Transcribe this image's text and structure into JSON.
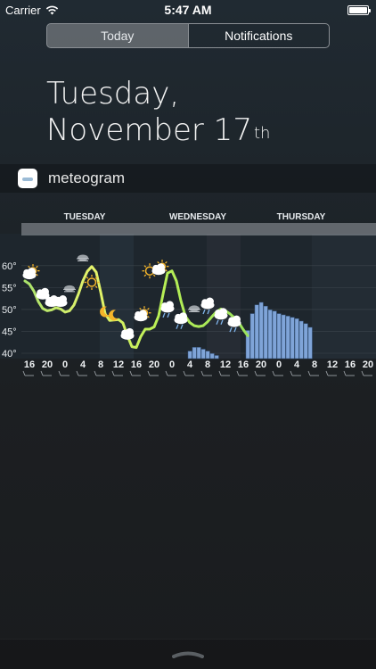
{
  "status_bar": {
    "carrier": "Carrier",
    "time": "5:47 AM"
  },
  "tabs": [
    {
      "label": "Today",
      "active": true
    },
    {
      "label": "Notifications",
      "active": false
    }
  ],
  "date_header": {
    "line1": "Tuesday,",
    "line2": "November 17",
    "suffix": "th"
  },
  "widget": {
    "title": "meteogram",
    "icon": "meteogram-app-icon"
  },
  "chart_data": {
    "type": "line",
    "days": [
      "TUESDAY",
      "WEDNESDAY",
      "THURSDAY"
    ],
    "x_tick_labels": [
      "16",
      "20",
      "0",
      "4",
      "8",
      "12",
      "16",
      "20",
      "0",
      "4",
      "8",
      "12",
      "16",
      "20",
      "0",
      "4",
      "8",
      "12",
      "16",
      "20"
    ],
    "y_tick_labels": [
      "60°",
      "55°",
      "50°",
      "45°",
      "40°"
    ],
    "ylim": [
      40,
      62
    ],
    "series": [
      {
        "values": [
          56.5,
          55.8,
          54.2,
          51.8,
          50.2,
          49.7,
          49.9,
          50.4,
          50.1,
          49.4,
          49.7,
          51.0,
          53.5,
          56.5,
          58.7,
          59.8,
          58.5,
          54.0,
          49.0,
          47.5,
          47.6,
          47.7,
          46.9,
          44.0,
          41.5,
          41.3,
          43.8,
          45.5,
          45.5,
          46.0,
          48.5,
          53.5,
          58.3,
          58.8,
          56.5,
          52.0,
          48.5,
          47.0,
          46.3,
          46.1,
          46.3,
          47.2,
          48.4,
          49.5,
          50.1,
          49.7,
          49.0,
          48.1,
          47.0,
          45.4,
          44.0
        ],
        "color": "#b8ef55"
      }
    ],
    "precipitation": [
      0,
      0,
      0,
      0,
      0,
      0,
      0,
      0,
      0,
      0,
      0,
      0,
      0,
      0,
      0,
      0,
      0,
      0,
      0,
      0,
      0,
      0,
      0,
      0,
      0,
      0,
      0,
      0,
      0,
      0,
      0,
      0,
      0,
      0,
      0,
      0,
      0,
      0.12,
      0.18,
      0.18,
      0.15,
      0.12,
      0.08,
      0.05,
      0,
      0,
      0,
      0,
      0,
      0,
      0.45,
      0.72,
      0.86,
      0.9,
      0.84,
      0.78,
      0.76,
      0.72,
      0.7,
      0.68,
      0.66,
      0.64,
      0.6,
      0.56,
      0.5
    ],
    "precip_color": "#7fa4d8",
    "weather_icons": [
      {
        "hour_index": 1,
        "temp": 57.8,
        "icon": "partly-cloudy-day-icon"
      },
      {
        "hour_index": 4,
        "temp": 53.2,
        "icon": "cloud-icon"
      },
      {
        "hour_index": 6,
        "temp": 51.5,
        "icon": "cloud-icon"
      },
      {
        "hour_index": 8,
        "temp": 51.5,
        "icon": "cloud-icon"
      },
      {
        "hour_index": 10,
        "temp": 54.8,
        "icon": "fog-icon"
      },
      {
        "hour_index": 13,
        "temp": 61.8,
        "icon": "fog-icon"
      },
      {
        "hour_index": 15,
        "temp": 56.2,
        "icon": "sun-icon"
      },
      {
        "hour_index": 18,
        "temp": 49.4,
        "icon": "moon-icon"
      },
      {
        "hour_index": 20,
        "temp": 48.6,
        "icon": "moon-icon"
      },
      {
        "hour_index": 23,
        "temp": 44.0,
        "icon": "cloud-icon"
      },
      {
        "hour_index": 26,
        "temp": 48.2,
        "icon": "partly-cloudy-day-icon"
      },
      {
        "hour_index": 28,
        "temp": 58.8,
        "icon": "sun-icon"
      },
      {
        "hour_index": 30,
        "temp": 58.8,
        "icon": "partly-cloudy-day-icon"
      },
      {
        "hour_index": 32,
        "temp": 50.2,
        "icon": "rain-cloud-icon"
      },
      {
        "hour_index": 35,
        "temp": 47.6,
        "icon": "rain-cloud-icon"
      },
      {
        "hour_index": 38,
        "temp": 50.2,
        "icon": "fog-icon"
      },
      {
        "hour_index": 41,
        "temp": 51.0,
        "icon": "rain-cloud-icon"
      },
      {
        "hour_index": 44,
        "temp": 48.6,
        "icon": "rain-cloud-icon"
      },
      {
        "hour_index": 47,
        "temp": 46.9,
        "icon": "rain-cloud-icon"
      }
    ]
  }
}
